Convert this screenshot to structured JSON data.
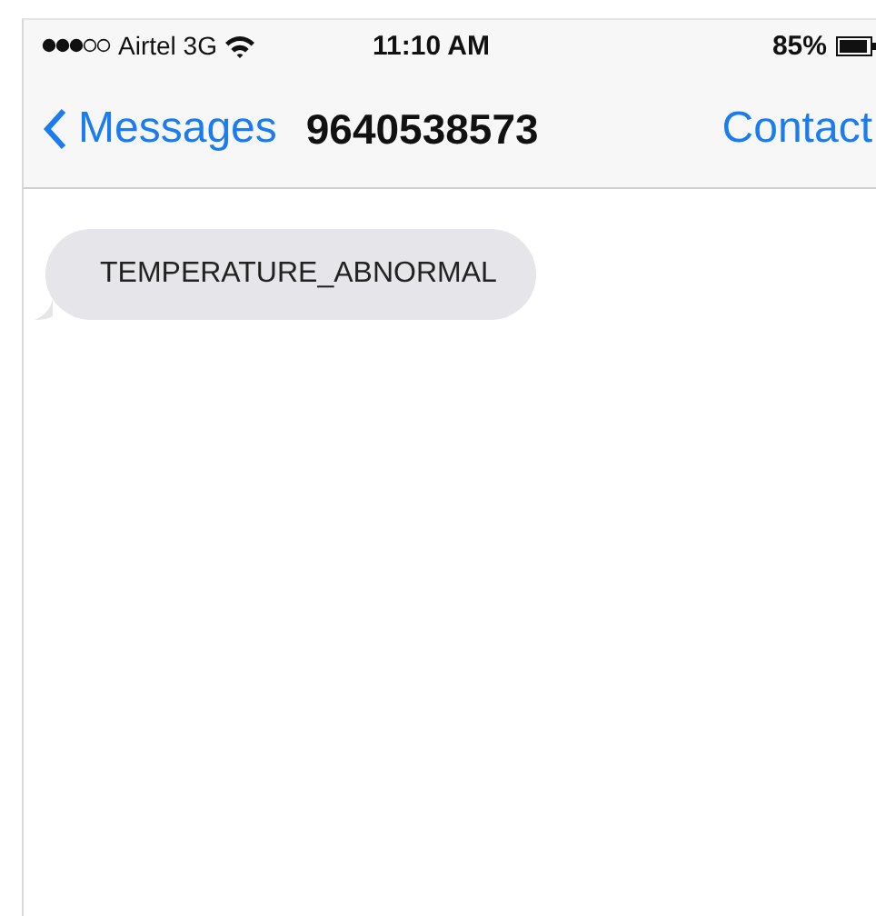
{
  "status_bar": {
    "carrier": "Airtel 3G",
    "time": "11:10 AM",
    "battery": "85%"
  },
  "nav_bar": {
    "back": "Messages",
    "title": "9640538573",
    "action": "Contact"
  },
  "messages": [
    {
      "kind": "incoming",
      "text": "TEMPERATURE_ABNORMAL"
    }
  ]
}
